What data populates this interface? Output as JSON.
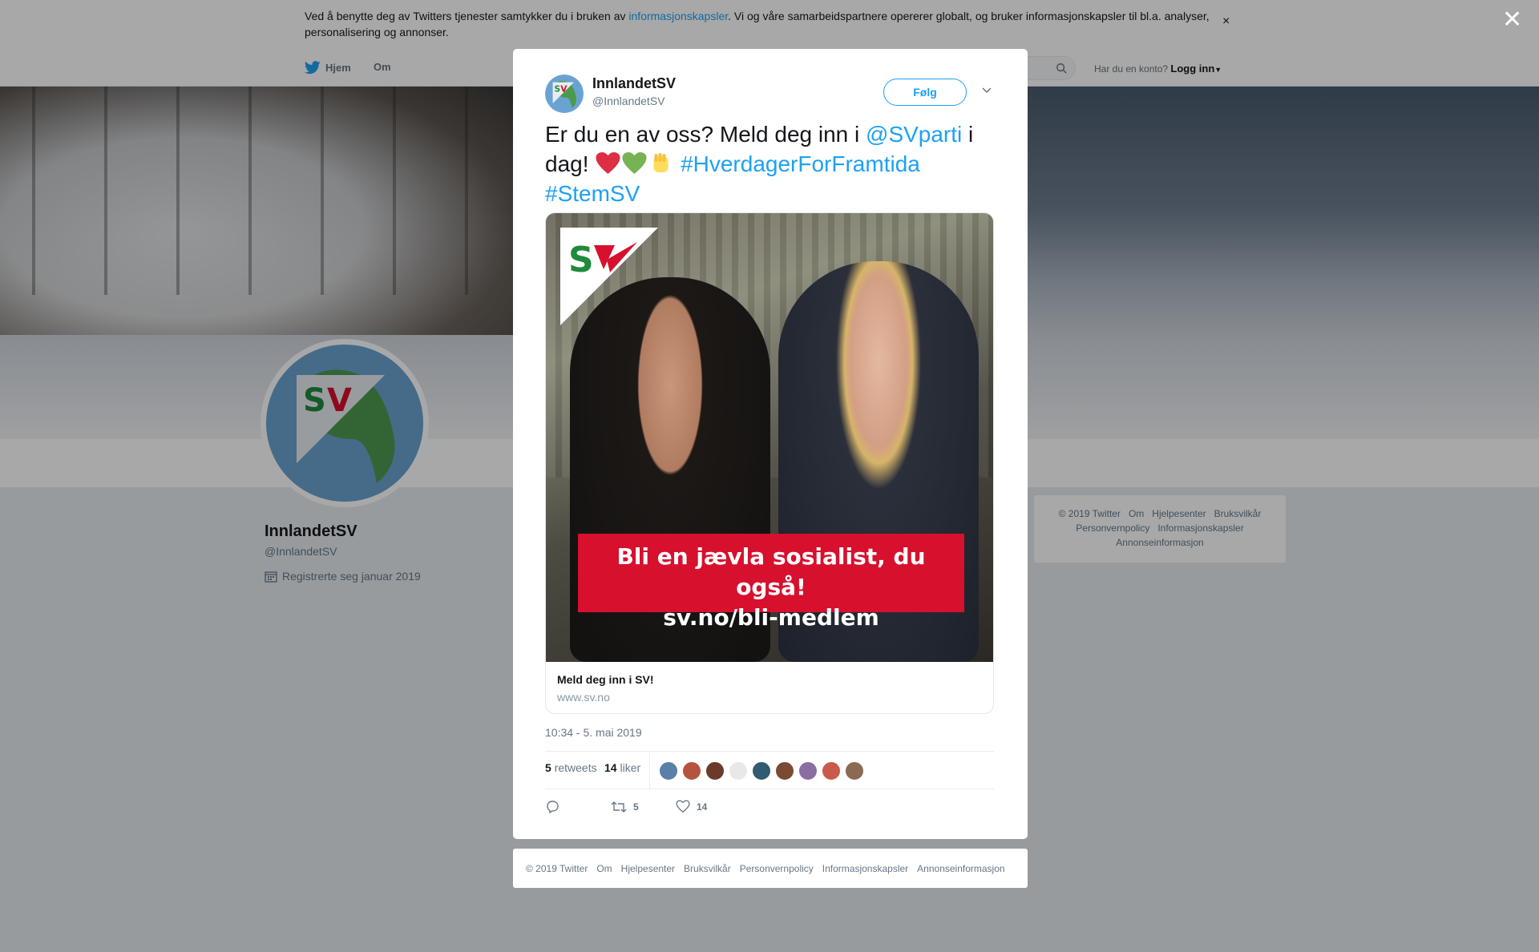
{
  "cookie_banner": {
    "text_before": "Ved å benytte deg av Twitters tjenester samtykker du i bruken av ",
    "link": "informasjonskapsler",
    "text_after": ". Vi og våre samarbeidspartnere opererer globalt, og bruker informasjonskapsler til bl.a. analyser, personalisering og annonser.",
    "close": "×"
  },
  "nav": {
    "home": "Hjem",
    "about": "Om",
    "has_account": "Har du en konto?",
    "login": "Logg inn"
  },
  "profile": {
    "name": "InnlandetSV",
    "handle": "@InnlandetSV",
    "joined": "Registrerte seg januar 2019"
  },
  "side_footer": [
    "© 2019 Twitter",
    "Om",
    "Hjelpesenter",
    "Bruksvilkår",
    "Personvernpolicy",
    "Informasjonskapsler",
    "Annonseinformasjon"
  ],
  "overlay_close": "✕",
  "tweet": {
    "author_name": "InnlandetSV",
    "author_handle": "@InnlandetSV",
    "follow_label": "Følg",
    "text_part1": "Er du en av oss? Meld deg inn i ",
    "mention": "@SVparti",
    "text_part2": " i dag! ",
    "hashtag1": "#HverdagerForFramtida",
    "hashtag2": "#StemSV",
    "emojis": [
      "red-heart",
      "green-heart",
      "raised-fist"
    ],
    "card": {
      "logo_text": "SV",
      "slogan_line1": "Bli en jævla sosialist, du også!",
      "slogan_line2": "sv.no/bli-medlem",
      "title": "Meld deg inn i SV!",
      "domain": "www.sv.no"
    },
    "timestamp": "10:34 - 5. mai 2019",
    "retweets_count": "5",
    "retweets_label": "retweets",
    "likes_count": "14",
    "likes_label": "liker",
    "liker_avatar_colors": [
      "#5b7fa6",
      "#b5543e",
      "#6b3a2a",
      "#e8e8e8",
      "#2f5c6e",
      "#7a4a33",
      "#8a6da3",
      "#c9594a",
      "#8a6a52"
    ],
    "action_reply": "",
    "action_retweet": "5",
    "action_like": "14"
  },
  "modal_footer": [
    "© 2019 Twitter",
    "Om",
    "Hjelpesenter",
    "Bruksvilkår",
    "Personvernpolicy",
    "Informasjonskapsler",
    "Annonseinformasjon"
  ],
  "colors": {
    "twitter_blue": "#1da1f2",
    "sv_red": "#d7102e",
    "sv_green": "#1f8a3c"
  }
}
